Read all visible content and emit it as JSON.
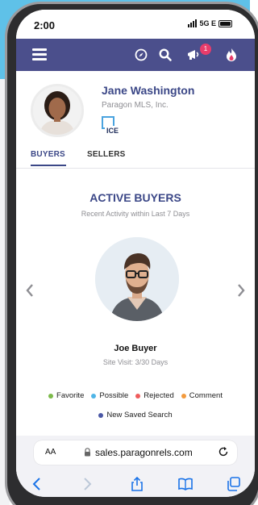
{
  "status_bar": {
    "time": "2:00",
    "network": "5G E"
  },
  "navbar": {
    "notification_count": "1"
  },
  "agent": {
    "name": "Jane Washington",
    "company": "Paragon MLS, Inc.",
    "logo_text": "ICE"
  },
  "tabs": [
    {
      "label": "BUYERS",
      "active": true
    },
    {
      "label": "SELLERS",
      "active": false
    }
  ],
  "section": {
    "title": "ACTIVE BUYERS",
    "subtitle": "Recent Activity within Last 7 Days"
  },
  "buyer": {
    "name": "Joe Buyer",
    "site_visit": "Site Visit: 3/30 Days"
  },
  "legend": [
    {
      "label": "Favorite",
      "color": "#7cba4a"
    },
    {
      "label": "Possible",
      "color": "#4fb5e7"
    },
    {
      "label": "Rejected",
      "color": "#ef5b5b"
    },
    {
      "label": "Comment",
      "color": "#f39a3d"
    },
    {
      "label": "New Saved Search",
      "color": "#4b58a6"
    }
  ],
  "browser": {
    "text_size_label": "AA",
    "url": "sales.paragonrels.com"
  },
  "colors": {
    "brand": "#4b4f8c",
    "accent_blue": "#3b4787",
    "toolbar_icons": "#1a73e8",
    "badge": "#e83c6b"
  }
}
